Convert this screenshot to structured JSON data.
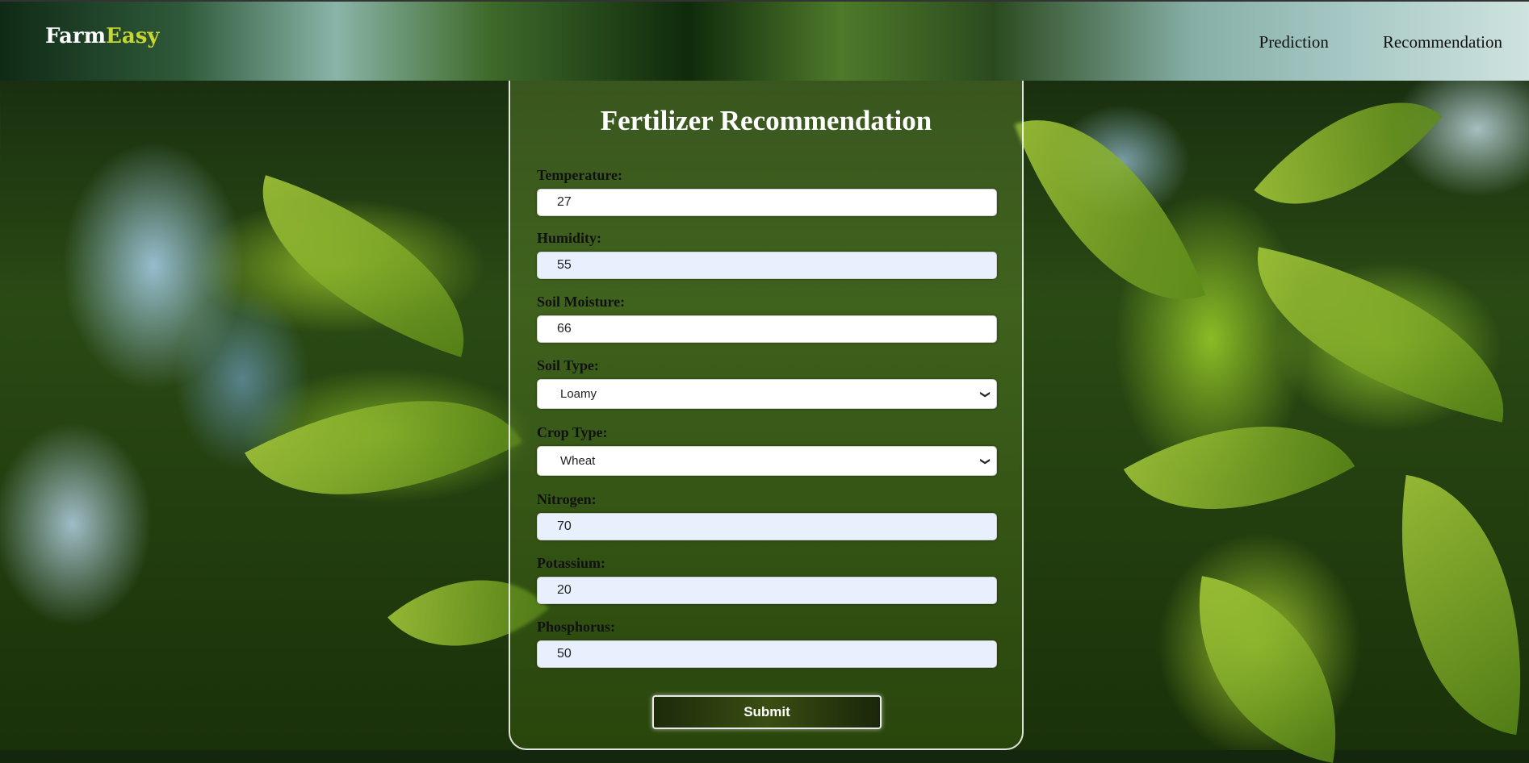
{
  "header": {
    "logo_part1": "Farm",
    "logo_part2": "Easy",
    "nav": [
      "Prediction",
      "Recommendation"
    ]
  },
  "form": {
    "title": "Fertilizer Recommendation",
    "fields": [
      {
        "label": "Temperature:",
        "value": "27"
      },
      {
        "label": "Humidity:",
        "value": "55"
      },
      {
        "label": "Soil Moisture:",
        "value": "66"
      },
      {
        "label": "Soil Type:",
        "value": "Loamy"
      },
      {
        "label": "Crop Type:",
        "value": "Wheat"
      },
      {
        "label": "Nitrogen:",
        "value": "70"
      },
      {
        "label": "Potassium:",
        "value": "20"
      },
      {
        "label": "Phosphorus:",
        "value": "50"
      }
    ],
    "submit_label": "Submit"
  },
  "colors": {
    "logo_accent": "#c8d632",
    "autofill_bg": "#e8f0fe"
  }
}
